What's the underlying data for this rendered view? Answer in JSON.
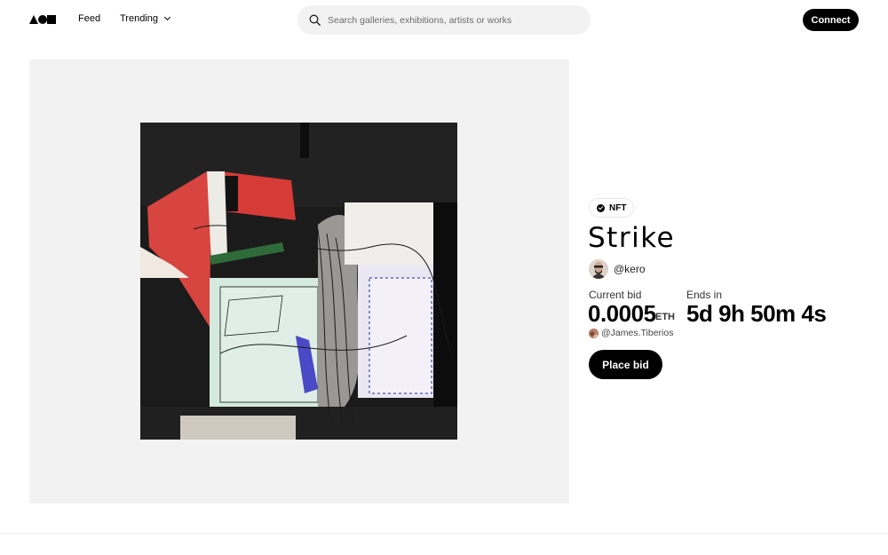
{
  "header": {
    "logo_name": "logo",
    "nav": {
      "feed_label": "Feed",
      "trending_label": "Trending"
    },
    "search": {
      "placeholder": "Search galleries, exhibitions, artists or works",
      "value": ""
    },
    "connect_label": "Connect"
  },
  "artwork": {
    "badge": "NFT",
    "title": "Strike",
    "artist_handle": "@kero",
    "current_bid_label": "Current bid",
    "current_bid_value": "0.0005",
    "current_bid_unit": "ETH",
    "top_bidder": "@James.Tiberios",
    "ends_label": "Ends in",
    "ends_value": "5d 9h 50m 4s",
    "place_bid_label": "Place bid"
  },
  "colors": {
    "accent": "#000000",
    "panel_bg": "#f2f2f2",
    "search_bg": "#f2f2f2"
  },
  "icons": [
    "logo-triangle-icon",
    "logo-circle-icon",
    "logo-square-icon",
    "chevron-down-icon",
    "search-icon",
    "verified-check-icon"
  ]
}
